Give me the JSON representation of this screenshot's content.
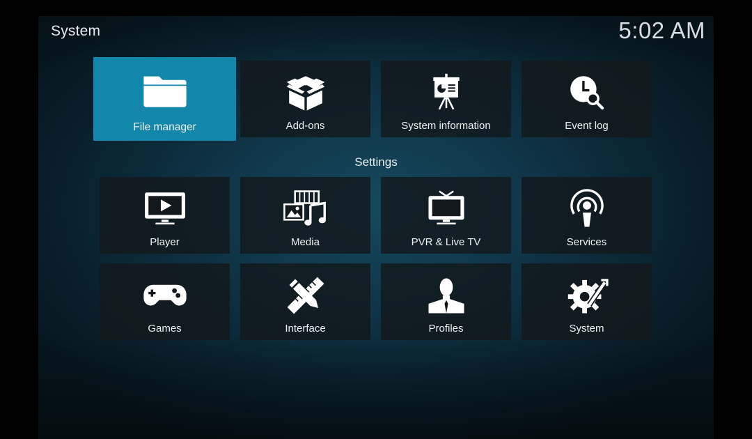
{
  "header": {
    "title": "System",
    "time": "5:02 AM"
  },
  "top_row": [
    {
      "label": "File manager",
      "icon": "folder-icon",
      "focused": true
    },
    {
      "label": "Add-ons",
      "icon": "open-box-icon"
    },
    {
      "label": "System information",
      "icon": "presentation-board-icon"
    },
    {
      "label": "Event log",
      "icon": "clock-search-icon"
    }
  ],
  "settings": {
    "heading": "Settings",
    "items": [
      {
        "label": "Player",
        "icon": "monitor-play-icon"
      },
      {
        "label": "Media",
        "icon": "media-filmstrip-music-icon"
      },
      {
        "label": "PVR & Live TV",
        "icon": "tv-antenna-icon"
      },
      {
        "label": "Services",
        "icon": "broadcast-podcast-icon"
      },
      {
        "label": "Games",
        "icon": "gamepad-icon"
      },
      {
        "label": "Interface",
        "icon": "pencil-ruler-icon"
      },
      {
        "label": "Profiles",
        "icon": "person-silhouette-icon"
      },
      {
        "label": "System",
        "icon": "gear-wrench-icon"
      }
    ]
  },
  "colors": {
    "focus": "#1287ab",
    "tile": "#12181c",
    "text": "#eef2f4"
  }
}
